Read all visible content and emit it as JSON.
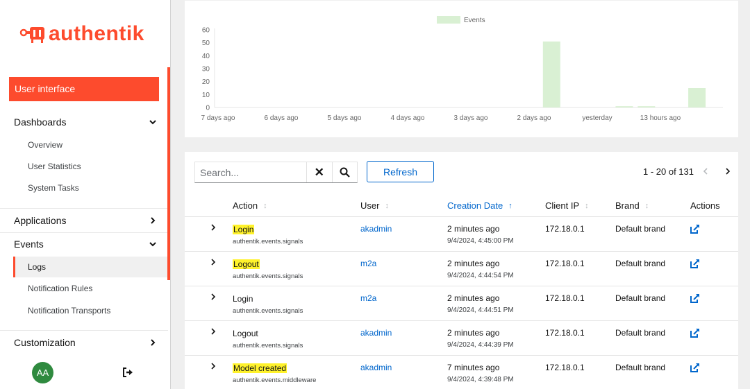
{
  "brand": {
    "logo_text": "authentik",
    "accent": "#fd4b2d"
  },
  "sidebar": {
    "user_interface": "User interface",
    "dashboards": {
      "label": "Dashboards",
      "items": [
        "Overview",
        "User Statistics",
        "System Tasks"
      ]
    },
    "applications": {
      "label": "Applications"
    },
    "events": {
      "label": "Events",
      "items": [
        "Logs",
        "Notification Rules",
        "Notification Transports"
      ],
      "active": "Logs"
    },
    "customization": {
      "label": "Customization"
    },
    "avatar_initials": "AA"
  },
  "chart_data": {
    "type": "bar",
    "legend": [
      "Events"
    ],
    "legend_position": "top-center",
    "ylim": [
      0,
      60
    ],
    "yticks": [
      0,
      10,
      20,
      30,
      40,
      50,
      60
    ],
    "xticks": [
      "7 days ago",
      "6 days ago",
      "5 days ago",
      "4 days ago",
      "3 days ago",
      "2 days ago",
      "yesterday",
      "13 hours ago"
    ],
    "series": [
      {
        "name": "Events",
        "color": "#d9f0d3",
        "points": [
          {
            "x": 5.3,
            "y": 51
          },
          {
            "x": 6.45,
            "y": 1
          },
          {
            "x": 6.8,
            "y": 1
          },
          {
            "x": 7.6,
            "y": 15
          }
        ]
      }
    ]
  },
  "table": {
    "search": {
      "placeholder": "Search..."
    },
    "refresh_label": "Refresh",
    "pagination": "1 - 20 of 131",
    "columns": [
      "Action",
      "User",
      "Creation Date",
      "Client IP",
      "Brand",
      "Actions"
    ],
    "sorted_column": "Creation Date",
    "rows": [
      {
        "action": "Login",
        "app": "authentik.events.signals",
        "user": "akadmin",
        "created_rel": "2 minutes ago",
        "created_abs": "9/4/2024, 4:45:00 PM",
        "client_ip": "172.18.0.1",
        "brand": "Default brand",
        "highlight": true
      },
      {
        "action": "Logout",
        "app": "authentik.events.signals",
        "user": "m2a",
        "created_rel": "2 minutes ago",
        "created_abs": "9/4/2024, 4:44:54 PM",
        "client_ip": "172.18.0.1",
        "brand": "Default brand",
        "highlight": true
      },
      {
        "action": "Login",
        "app": "authentik.events.signals",
        "user": "m2a",
        "created_rel": "2 minutes ago",
        "created_abs": "9/4/2024, 4:44:51 PM",
        "client_ip": "172.18.0.1",
        "brand": "Default brand",
        "highlight": false
      },
      {
        "action": "Logout",
        "app": "authentik.events.signals",
        "user": "akadmin",
        "created_rel": "2 minutes ago",
        "created_abs": "9/4/2024, 4:44:39 PM",
        "client_ip": "172.18.0.1",
        "brand": "Default brand",
        "highlight": false
      },
      {
        "action": "Model created",
        "app": "authentik.events.middleware",
        "user": "akadmin",
        "created_rel": "7 minutes ago",
        "created_abs": "9/4/2024, 4:39:48 PM",
        "client_ip": "172.18.0.1",
        "brand": "Default brand",
        "highlight": true
      }
    ]
  }
}
